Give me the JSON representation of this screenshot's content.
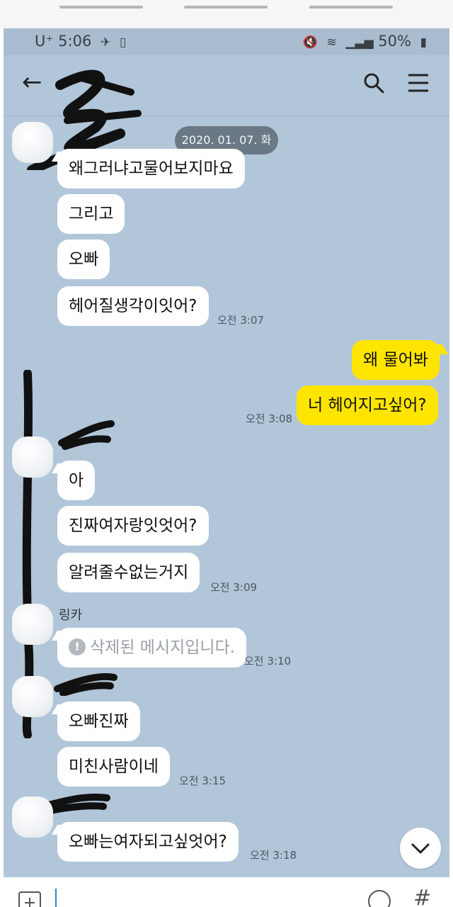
{
  "status_bar": {
    "carrier": "U⁺",
    "time": "5:06",
    "battery": "50%"
  },
  "chat": {
    "date_divider": "2020. 01. 07. 화",
    "messages": [
      {
        "side": "in",
        "text": "왜그러냐고물어보지마요"
      },
      {
        "side": "in",
        "text": "그리고"
      },
      {
        "side": "in",
        "text": "오빠"
      },
      {
        "side": "in",
        "text": "헤어질생각이잇어?",
        "time": "오전 3:07"
      },
      {
        "side": "out",
        "text": "왜 물어봐"
      },
      {
        "side": "out",
        "text": "너 헤어지고싶어?",
        "time": "오전 3:08"
      },
      {
        "side": "in",
        "text": "아"
      },
      {
        "side": "in",
        "text": "진짜여자랑잇엇어?"
      },
      {
        "side": "in",
        "text": "알려줄수없는거지",
        "time": "오전 3:09"
      },
      {
        "side": "in",
        "sender": "링카",
        "text": "삭제된 메시지입니다.",
        "deleted": true,
        "time": "오전 3:10"
      },
      {
        "side": "in",
        "text": "오빠진짜"
      },
      {
        "side": "in",
        "text": "미친사람이네",
        "time": "오전 3:15"
      },
      {
        "side": "in",
        "text": "오빠는여자되고싶엇어?",
        "time": "오전 3:18"
      }
    ]
  },
  "icons": {
    "back": "back-arrow-icon",
    "search": "search-icon",
    "menu": "menu-icon",
    "scroll_down": "chevron-down-icon",
    "attach": "plus-icon",
    "emoji": "emoji-icon",
    "hash": "hash-icon"
  },
  "colors": {
    "chat_background": "#b2c6d9",
    "outgoing_bubble": "#fee500",
    "incoming_bubble": "#ffffff",
    "date_pill": "#6b7886"
  }
}
